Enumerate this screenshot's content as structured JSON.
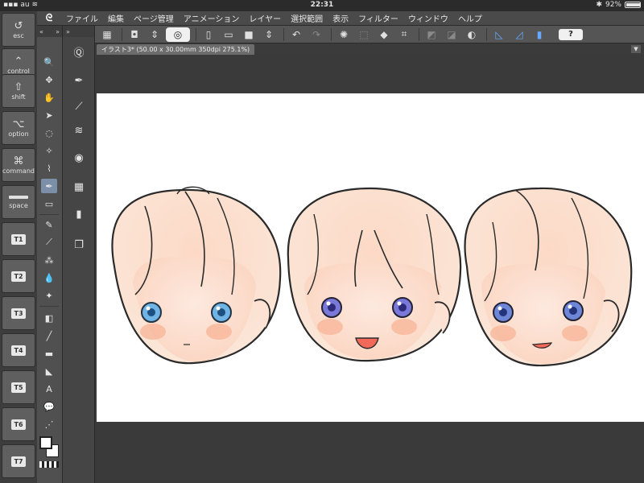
{
  "status_bar": {
    "carrier": "au",
    "time": "22:31",
    "battery": "92%"
  },
  "app": {
    "logo": "CSP"
  },
  "menu": {
    "items": [
      "ファイル",
      "編集",
      "ページ管理",
      "アニメーション",
      "レイヤー",
      "選択範囲",
      "表示",
      "フィルター",
      "ウィンドウ",
      "ヘルプ"
    ]
  },
  "command_bar": {
    "help_label": "?"
  },
  "modifiers": {
    "esc": "esc",
    "control": "control",
    "shift": "shift",
    "option": "option",
    "command": "command",
    "space": "space"
  },
  "shortcut_keys": [
    "T1",
    "T2",
    "T3",
    "T4",
    "T5",
    "T6",
    "T7"
  ],
  "tool_palette": {
    "tab_left": "«",
    "tab_right": "»"
  },
  "document": {
    "tab_title": "イラスト3* (50.00 x 30.00mm 350dpi 275.1%)"
  },
  "colors": {
    "main_color": "#ffffff",
    "sub_color": "#ffffff",
    "accent": "#7c8fa8"
  }
}
